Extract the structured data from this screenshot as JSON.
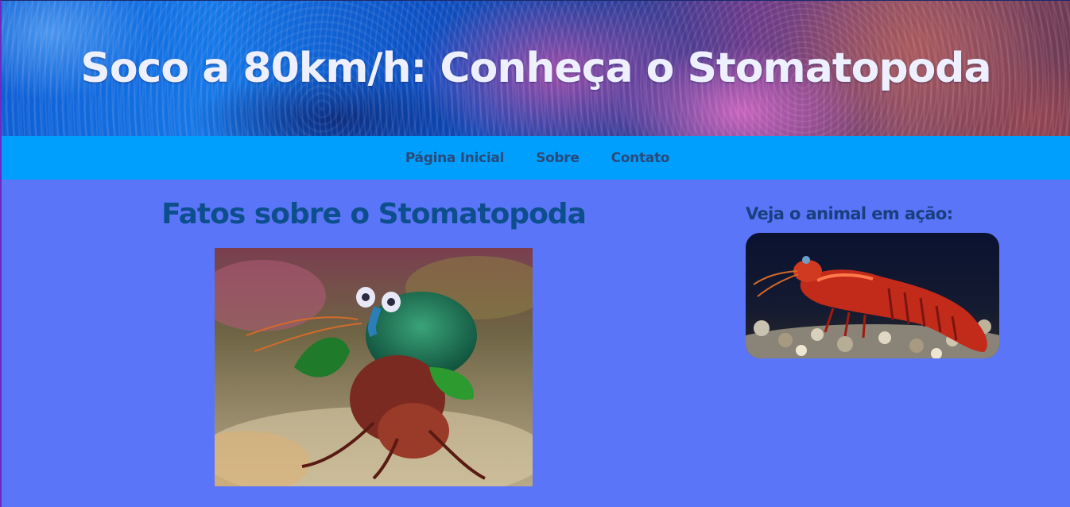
{
  "header": {
    "title": "Soco a 80km/h: Conheça o Stomatopoda"
  },
  "nav": {
    "items": [
      {
        "label": "Página Inicial"
      },
      {
        "label": "Sobre"
      },
      {
        "label": "Contato"
      }
    ]
  },
  "main": {
    "heading": "Fatos sobre o Stomatopoda",
    "image_icon": "mantis-shrimp-photo"
  },
  "sidebar": {
    "heading": "Veja o animal em ação:",
    "image_icon": "mantis-shrimp-video-thumbnail"
  },
  "colors": {
    "page_background": "#5b75f8",
    "nav_background": "#009ffd",
    "nav_text": "#2b4a7a",
    "heading": "#0d4f8c",
    "banner_title": "#eef0ff"
  }
}
